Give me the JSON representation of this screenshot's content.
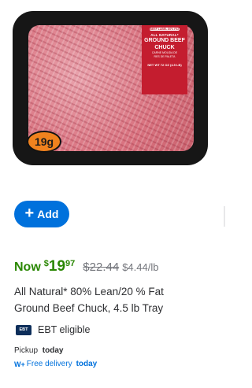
{
  "product_image": {
    "package": {
      "brand": "BEEF LABEL 80% FAT",
      "natural": "ALL NATURAL*",
      "name_line1": "GROUND BEEF",
      "name_line2": "CHUCK",
      "spanish": "CARNE MOLIDA DE",
      "spanish2": "RES DE PALETA",
      "weight": "NET WT 72 OZ (4.5 LB)"
    },
    "weight_badge": "19g"
  },
  "add_button": {
    "icon": "plus-icon",
    "label": "Add"
  },
  "price": {
    "now_label": "Now",
    "currency": "$",
    "dollars": "19",
    "cents": "97",
    "was": "$22.44",
    "unit": "$4.44/lb"
  },
  "title": {
    "line1": "All Natural* 80% Lean/20 % Fat",
    "line2": "Ground Beef Chuck, 4.5 lb Tray"
  },
  "ebt": {
    "icon_text": "EBT",
    "label": "EBT eligible"
  },
  "pickup": {
    "prefix": "Pickup",
    "when": "today"
  },
  "delivery": {
    "icon": "W+",
    "prefix": "Free delivery",
    "when": "today"
  },
  "colors": {
    "accent": "#0071dc",
    "price_green": "#2a8703",
    "muted": "#74767c"
  }
}
